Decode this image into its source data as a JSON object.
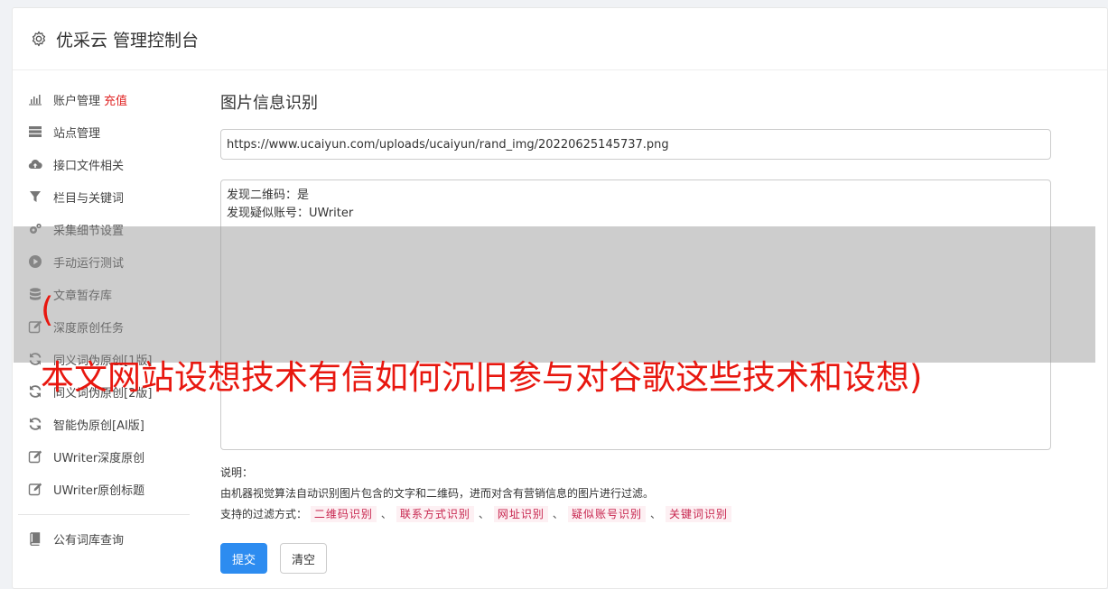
{
  "header": {
    "title": "优采云 管理控制台",
    "icon": "gear-icon"
  },
  "sidebar": {
    "items": [
      {
        "label": "账户管理",
        "extra": "充值",
        "icon": "bar-chart-icon"
      },
      {
        "label": "站点管理",
        "icon": "server-icon"
      },
      {
        "label": "接口文件相关",
        "icon": "cloud-upload-icon"
      },
      {
        "label": "栏目与关键词",
        "icon": "filter-icon"
      },
      {
        "label": "采集细节设置",
        "icon": "gears-icon"
      },
      {
        "label": "手动运行测试",
        "icon": "play-circle-icon"
      },
      {
        "label": "文章暂存库",
        "icon": "database-icon"
      },
      {
        "label": "深度原创任务",
        "icon": "edit-icon"
      },
      {
        "label": "同义词伪原创[1版]",
        "icon": "refresh-icon"
      },
      {
        "label": "同义词伪原创[2版]",
        "icon": "refresh-icon"
      },
      {
        "label": "智能伪原创[AI版]",
        "icon": "refresh-icon"
      },
      {
        "label": "UWriter深度原创",
        "icon": "edit-icon"
      },
      {
        "label": "UWriter原创标题",
        "icon": "edit-icon"
      }
    ],
    "bottom_items": [
      {
        "label": "公有词库查询",
        "icon": "book-icon"
      }
    ]
  },
  "main": {
    "title": "图片信息识别",
    "url_value": "https://www.ucaiyun.com/uploads/ucaiyun/rand_img/20220625145737.png",
    "result_lines": [
      "发现二维码：是",
      "发现疑似账号：UWriter"
    ],
    "desc_label": "说明：",
    "desc_text": "由机器视觉算法自动识别图片包含的文字和二维码，进而对含有营销信息的图片进行过滤。",
    "filter_label": "支持的过滤方式：",
    "filters": [
      "二维码识别",
      "联系方式识别",
      "网址识别",
      "疑似账号识别",
      "关键词识别"
    ],
    "separator": "、",
    "submit_label": "提交",
    "clear_label": "清空"
  },
  "overlay": {
    "line1": "(",
    "line2": "本文网站设想技术有信如何沉旧参与对谷歌这些技术和设想)"
  },
  "colors": {
    "accent": "#2d8cf0",
    "danger": "#e02424",
    "tag_text": "#c7254e",
    "tag_bg": "#fdf0f3",
    "overlay_text": "#e8170f"
  }
}
